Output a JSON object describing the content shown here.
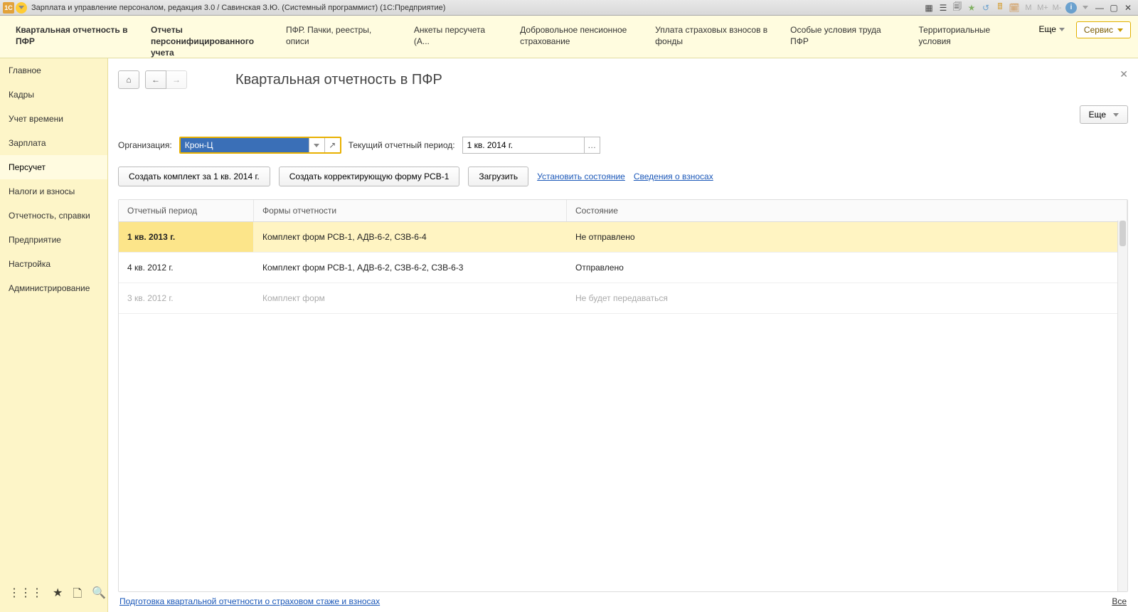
{
  "titlebar": {
    "text": "Зарплата и управление персоналом, редакция 3.0 / Савинская З.Ю. (Системный программист)  (1С:Предприятие)",
    "m1": "M",
    "m2": "M+",
    "m3": "M-"
  },
  "topnav": {
    "items": [
      "Квартальная отчетность в ПФР",
      "Отчеты персонифицированного учета",
      "ПФР. Пачки, реестры, описи",
      "Анкеты персучета (А...",
      "Добровольное пенсионное страхование",
      "Уплата страховых взносов в фонды",
      "Особые условия труда ПФР",
      "Территориальные условия"
    ],
    "more": "Еще",
    "service": "Сервис"
  },
  "sidebar": {
    "items": [
      "Главное",
      "Кадры",
      "Учет времени",
      "Зарплата",
      "Персучет",
      "Налоги и взносы",
      "Отчетность, справки",
      "Предприятие",
      "Настройка",
      "Администрирование"
    ]
  },
  "page": {
    "title": "Квартальная отчетность в ПФР",
    "more": "Еще"
  },
  "filters": {
    "org_label": "Организация:",
    "org_value": "Крон-Ц",
    "period_label": "Текущий отчетный период:",
    "period_value": "1 кв. 2014 г."
  },
  "actions": {
    "create_set": "Создать комплект за 1 кв. 2014 г.",
    "create_corr": "Создать корректирующую форму РСВ-1",
    "load": "Загрузить",
    "set_state": "Установить состояние",
    "contrib_info": "Сведения о взносах"
  },
  "grid": {
    "headers": {
      "c1": "Отчетный период",
      "c2": "Формы отчетности",
      "c3": "Состояние"
    },
    "rows": [
      {
        "c1": "1 кв. 2013 г.",
        "c2": "Комплект форм РСВ-1, АДВ-6-2, СЗВ-6-4",
        "c3": "Не отправлено",
        "sel": true,
        "red": true
      },
      {
        "c1": "4 кв. 2012 г.",
        "c2": "Комплект форм РСВ-1, АДВ-6-2, СЗВ-6-2, СЗВ-6-3",
        "c3": "Отправлено"
      },
      {
        "c1": "3 кв. 2012 г.",
        "c2": "Комплект форм",
        "c3": "Не будет передаваться",
        "disabled": true
      }
    ]
  },
  "footer": {
    "link": "Подготовка квартальной отчетности о страховом стаже и взносах",
    "all": "Все"
  }
}
